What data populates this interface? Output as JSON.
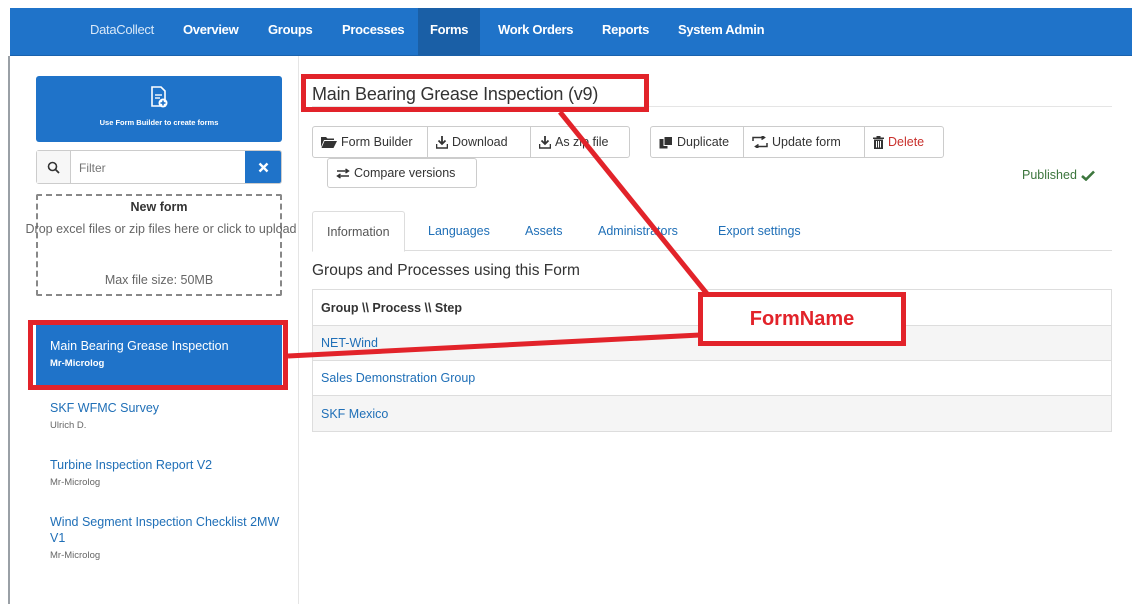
{
  "navbar": {
    "brand": "DataCollect",
    "items": [
      {
        "label": "Overview"
      },
      {
        "label": "Groups"
      },
      {
        "label": "Processes"
      },
      {
        "label": "Forms",
        "active": true
      },
      {
        "label": "Work Orders"
      },
      {
        "label": "Reports"
      },
      {
        "label": "System Admin"
      }
    ]
  },
  "sidebar": {
    "builder_label": "Use Form Builder to create forms",
    "filter_placeholder": "Filter",
    "dropzone": {
      "title": "New form",
      "text": "Drop excel files or zip files here or click to upload",
      "max_size": "Max file size: 50MB"
    },
    "forms": [
      {
        "title": "Main Bearing Grease Inspection",
        "author": "Mr-Microlog",
        "selected": true
      },
      {
        "title": "SKF WFMC Survey",
        "author": "Ulrich D."
      },
      {
        "title": "Turbine Inspection Report V2",
        "author": "Mr-Microlog"
      },
      {
        "title": "Wind Segment Inspection Checklist 2MW V1",
        "author": "Mr-Microlog"
      }
    ]
  },
  "main": {
    "form_title": "Main Bearing Grease Inspection (v9)",
    "toolbar": {
      "form_builder": "Form Builder",
      "download": "Download",
      "as_zip": "As zip file",
      "duplicate": "Duplicate",
      "update_form": "Update form",
      "delete": "Delete",
      "compare_versions": "Compare versions"
    },
    "status": "Published",
    "tabs": [
      {
        "label": "Information",
        "active": true
      },
      {
        "label": "Languages"
      },
      {
        "label": "Assets"
      },
      {
        "label": "Administrators"
      },
      {
        "label": "Export settings"
      }
    ],
    "groups_heading": "Groups and Processes using this Form",
    "table": {
      "header": "Group \\\\ Process \\\\ Step",
      "rows": [
        "NET-Wind",
        "Sales Demonstration Group",
        "SKF Mexico"
      ]
    }
  },
  "annotation": {
    "callout": "FormName",
    "color": "#e2232a"
  },
  "colors": {
    "primary": "#1f73c9",
    "link": "#1f6fb7",
    "success": "#3c763d",
    "danger": "#c9302c"
  }
}
